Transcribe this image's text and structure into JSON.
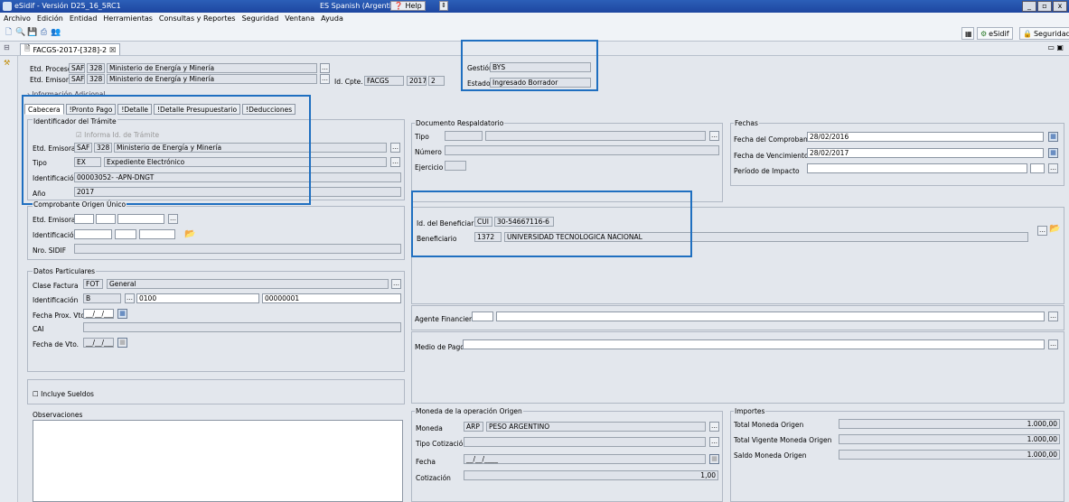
{
  "window": {
    "title": "eSidif - Versión D25_16_5RC1",
    "language": "ES Spanish (Argentina)",
    "help": "Help",
    "minimize": "_",
    "maximize": "▫",
    "close": "x"
  },
  "menu": [
    "Archivo",
    "Edición",
    "Entidad",
    "Herramientas",
    "Consultas y Reportes",
    "Seguridad",
    "Ventana",
    "Ayuda"
  ],
  "toolbar_right": {
    "esidif": "eSidif",
    "seguridad": "Seguridad"
  },
  "doc_tab": {
    "label": "FACGS-2017-[328]-2",
    "close": "☒"
  },
  "header": {
    "etd_proceso_label": "Etd. Proceso",
    "etd_proceso_code": "SAF",
    "etd_proceso_num": "328",
    "etd_proceso_name": "Ministerio de Energía y Minería",
    "etd_emisora_label": "Etd. Emisora",
    "etd_emisora_code": "SAF",
    "etd_emisora_num": "328",
    "etd_emisora_name": "Ministerio de Energía y Minería",
    "id_cpte_label": "Id. Cpte.",
    "id_cpte_type": "FACGS",
    "id_cpte_year": "2017",
    "id_cpte_num": "2",
    "gestion_label": "Gestión",
    "gestion_value": "BYS",
    "estado_label": "Estado",
    "estado_value": "Ingresado Borrador",
    "info_adicional": "› Información Adicional"
  },
  "subtabs": [
    "Cabecera",
    "!Pronto Pago",
    "!Detalle",
    "!Detalle Presupuestario",
    "!Deducciones"
  ],
  "tramite": {
    "title": "Identificador del Trámite",
    "informa": "Informa Id. de Trámite",
    "etd_emisora_label": "Etd. Emisora",
    "etd_code": "SAF",
    "etd_num": "328",
    "etd_name": "Ministerio de Energía y Minería",
    "tipo_label": "Tipo",
    "tipo_code": "EX",
    "tipo_name": "Expediente Electrónico",
    "identificacion_label": "Identificación",
    "identificacion_value": "00003052- -APN-DNGT",
    "anio_label": "Año",
    "anio_value": "2017"
  },
  "origen": {
    "title": "Comprobante Origen Único",
    "etd_emisora_label": "Etd. Emisora",
    "identificacion_label": "Identificación",
    "nro_sidif_label": "Nro. SIDIF"
  },
  "particulares": {
    "title": "Datos Particulares",
    "clase_label": "Clase Factura",
    "clase_code": "FOT",
    "clase_name": "General",
    "identificacion_label": "Identificación",
    "ident_letra": "B",
    "ident_pv": "0100",
    "ident_num": "00000001",
    "fecha_prox_label": "Fecha Prox. Vto.",
    "fecha_prox_value": "__/__/____",
    "cai_label": "CAI",
    "fecha_vto_label": "Fecha de Vto.",
    "fecha_vto_value": "__/__/____"
  },
  "incluye_sueldos": "Incluye Sueldos",
  "observaciones": "Observaciones",
  "documento": {
    "title": "Documento Respaldatorio",
    "tipo_label": "Tipo",
    "numero_label": "Número",
    "ejercicio_label": "Ejercicio"
  },
  "fechas": {
    "title": "Fechas",
    "comprobante_label": "Fecha del Comprobante",
    "comprobante_value": "28/02/2016",
    "vencimiento_label": "Fecha de Vencimiento",
    "vencimiento_value": "28/02/2017",
    "periodo_label": "Período de Impacto"
  },
  "beneficiario": {
    "id_label": "Id. del Beneficiario",
    "id_type": "CUI",
    "id_value": "30-54667116-6",
    "label": "Beneficiario",
    "code": "1372",
    "name": "UNIVERSIDAD TECNOLOGICA NACIONAL"
  },
  "agente_label": "Agente Financiero",
  "medio_pago_label": "Medio de Pago",
  "moneda": {
    "title": "Moneda de la operación Origen",
    "moneda_label": "Moneda",
    "moneda_code": "ARP",
    "moneda_name": "PESO ARGENTINO",
    "tipo_cot_label": "Tipo Cotización",
    "fecha_label": "Fecha",
    "fecha_value": "__/__/____",
    "cotizacion_label": "Cotización",
    "cotizacion_value": "1,00"
  },
  "importes": {
    "title": "Importes",
    "total_label": "Total Moneda Origen",
    "total_value": "1.000,00",
    "vigente_label": "Total Vigente Moneda Origen",
    "vigente_value": "1.000,00",
    "saldo_label": "Saldo Moneda Origen",
    "saldo_value": "1.000,00"
  },
  "colors": {
    "highlight": "#1f6fc0",
    "titlebar": "#2c5fb8"
  }
}
